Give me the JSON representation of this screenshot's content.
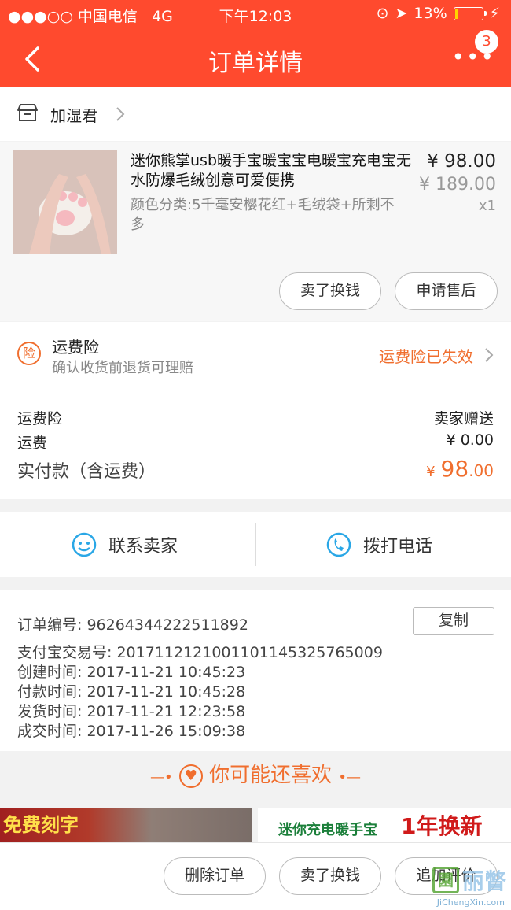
{
  "status_bar": {
    "carrier": "●●●○○ 中国电信",
    "network": "4G",
    "time": "下午12:03",
    "battery": "13%",
    "battery_level": 0.13
  },
  "nav": {
    "title": "订单详情",
    "more": "•••",
    "badge_count": "3"
  },
  "store": {
    "name": "加湿君"
  },
  "product": {
    "title": "迷你熊掌usb暖手宝暖宝宝电暖宝充电宝无水防爆毛绒创意可爱便携",
    "sku": "颜色分类:5千毫安樱花红+毛绒袋+所剩不多",
    "price": "¥ 98.00",
    "original_price": "¥ 189.00",
    "quantity": "x1",
    "buttons": {
      "sell": "卖了换钱",
      "after_sale": "申请售后"
    }
  },
  "insurance": {
    "icon_text": "险",
    "title": "运费险",
    "subtitle": "确认收货前退货可理赔",
    "status": "运费险已失效"
  },
  "fees": {
    "insurance_label": "运费险",
    "insurance_value": "卖家赠送",
    "shipping_label": "运费",
    "shipping_value": "¥ 0.00",
    "paid_label": "实付款（含运费）",
    "paid_symbol": "¥",
    "paid_integer": "98",
    "paid_decimal": ".00"
  },
  "contact": {
    "seller": "联系卖家",
    "phone": "拨打电话"
  },
  "info": {
    "order_no": "订单编号:  96264344222511892",
    "copy": "复制",
    "alipay_no": "支付宝交易号:  2017112121001101145325765009",
    "created": "创建时间:  2017-11-21 10:45:23",
    "paid": "付款时间:  2017-11-21 10:45:28",
    "shipped": "发货时间:  2017-11-21 12:23:58",
    "completed": "成交时间:  2017-11-26 15:09:38"
  },
  "recommend": {
    "title": "你可能还喜欢",
    "banner_left": "免费刻字",
    "banner_right_1": "迷你充电暖手宝",
    "banner_right_2": "1年换新"
  },
  "bottom": {
    "delete": "删除订单",
    "sell": "卖了换钱",
    "review": "追加评价"
  },
  "watermark": {
    "box": "園",
    "text": "丽瞥",
    "url": "JiChengXin.com"
  },
  "colors": {
    "brand": "#ff4a2e",
    "accent": "#f06e2e",
    "link_blue": "#2aa7e6"
  }
}
